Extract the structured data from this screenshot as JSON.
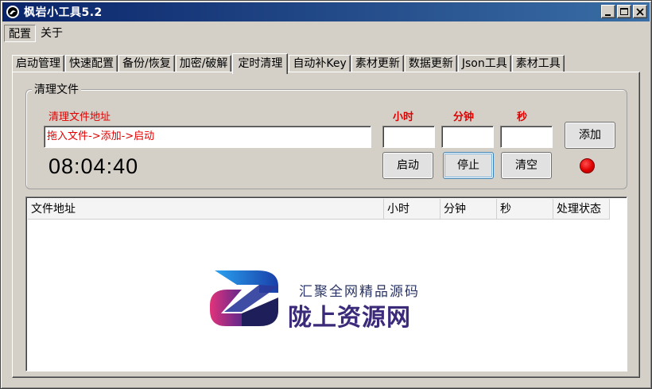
{
  "window": {
    "title": "枫岩小工具5.2"
  },
  "menu": [
    "配置",
    "关于"
  ],
  "tabs": [
    "启动管理",
    "快速配置",
    "备份/恢复",
    "加密/破解",
    "定时清理",
    "自动补Key",
    "素材更新",
    "数据更新",
    "Json工具",
    "素材工具"
  ],
  "active_tab": "定时清理",
  "group": {
    "legend": "清理文件",
    "path_label": "清理文件地址",
    "path_value": "拖入文件->添加->启动",
    "hour_label": "小时",
    "minute_label": "分钟",
    "second_label": "秒",
    "hour_value": "",
    "minute_value": "",
    "second_value": "",
    "clock": "08:04:40",
    "add_label": "添加",
    "start_label": "启动",
    "stop_label": "停止",
    "clear_label": "清空",
    "status_color": "#e00000"
  },
  "table": {
    "columns": [
      "文件地址",
      "小时",
      "分钟",
      "秒",
      "处理状态"
    ],
    "rows": []
  },
  "watermark": {
    "slogan": "汇聚全网精品源码",
    "name": "陇上资源网"
  },
  "colors": {
    "titlebar_start": "#0a246a",
    "titlebar_end": "#3a6ea5",
    "label_red": "#e00000",
    "face": "#d4d0c8"
  }
}
